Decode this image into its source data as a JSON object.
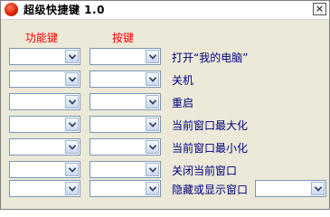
{
  "window": {
    "title": "超级快捷键 1.0",
    "close_glyph": "×"
  },
  "headers": {
    "function_key": "功能键",
    "key": "按键"
  },
  "rows": [
    {
      "action": "打开“我的电脑”"
    },
    {
      "action": "关机"
    },
    {
      "action": "重启"
    },
    {
      "action": "当前窗口最大化"
    },
    {
      "action": "当前窗口最小化"
    },
    {
      "action": "关闭当前窗口"
    },
    {
      "action": "隐藏或显示窗口"
    }
  ],
  "icons": {
    "app": "app-ball-icon",
    "close": "close-icon",
    "dropdown": "chevron-down-icon"
  }
}
